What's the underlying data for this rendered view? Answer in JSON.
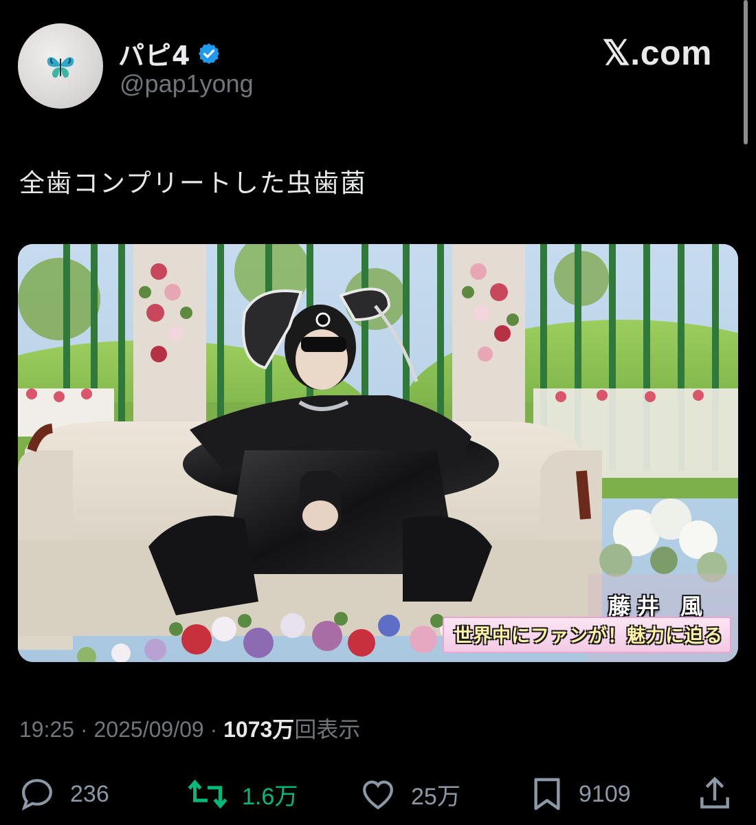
{
  "author": {
    "display_name": "パピ4",
    "handle": "@pap1yong",
    "verified": true,
    "avatar_icon": "butterfly-icon"
  },
  "brand": "𝕏.com",
  "tweet": {
    "text": "全歯コンプリートした虫歯菌"
  },
  "media": {
    "caption_name": "藤井 風",
    "caption_sub": "世界中にファンが！魅力に迫る"
  },
  "meta": {
    "time": "19:25",
    "separator": "·",
    "date": "2025/09/09",
    "views_count": "1073",
    "views_unit": "万",
    "views_label": "回表示"
  },
  "actions": {
    "replies": "236",
    "reposts": "1.6万",
    "likes": "25万",
    "bookmarks": "9109"
  },
  "colors": {
    "background": "#000000",
    "text_primary": "#e7e9ea",
    "text_secondary": "#71767b",
    "repost_active": "#00ba7c",
    "verified_blue": "#1d9bf0"
  }
}
